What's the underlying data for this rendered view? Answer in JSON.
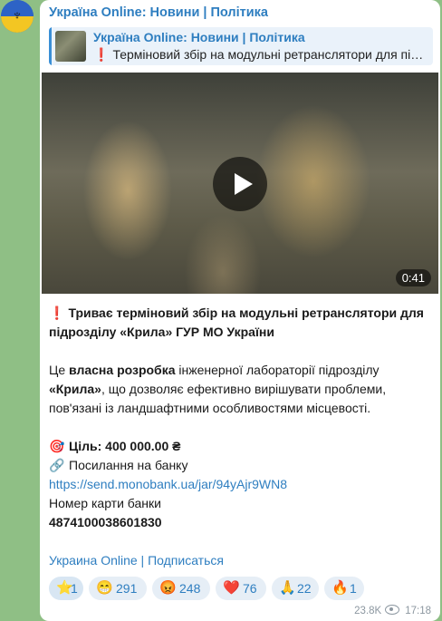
{
  "channel": {
    "title": "Україна Online: Новини | Політика"
  },
  "reply": {
    "title": "Україна Online: Новини | Політика",
    "excl": "❗",
    "text": "Терміновий збір на модульні ретранслятори для пі…"
  },
  "video": {
    "duration": "0:41"
  },
  "post": {
    "excl": "❗",
    "headline": "Триває терміновий збір на модульні ретранслятори для підрозділу «Крила» ГУР МО України",
    "p2_a": "Це ",
    "p2_b": "власна розробка",
    "p2_c": " інженерної лабораторії підрозділу ",
    "p2_d": "«Крила»",
    "p2_e": ", що дозволяє ефективно вирішувати проблеми, пов'язані із ландшафтними особливостями місцевості.",
    "goal_emoji": "🎯",
    "goal": "Ціль: 400 000.00 ₴",
    "bank_emoji": "🔗",
    "bank": "Посилання на банку",
    "url": "https://send.monobank.ua/jar/94yAjr9WN8",
    "card_label": "Номер карти банки",
    "card_number": "4874100038601830",
    "footer_a": "Украина Online",
    "footer_sep": " | ",
    "footer_b": "Подписаться"
  },
  "reactions": [
    {
      "emoji": "⭐",
      "count": "1"
    },
    {
      "emoji": "😁",
      "count": "291"
    },
    {
      "emoji": "😡",
      "count": "248"
    },
    {
      "emoji": "❤️",
      "count": "76"
    },
    {
      "emoji": "🙏",
      "count": "22"
    },
    {
      "emoji": "🔥",
      "count": "1"
    }
  ],
  "meta": {
    "views": "23.8K",
    "time": "17:18"
  }
}
